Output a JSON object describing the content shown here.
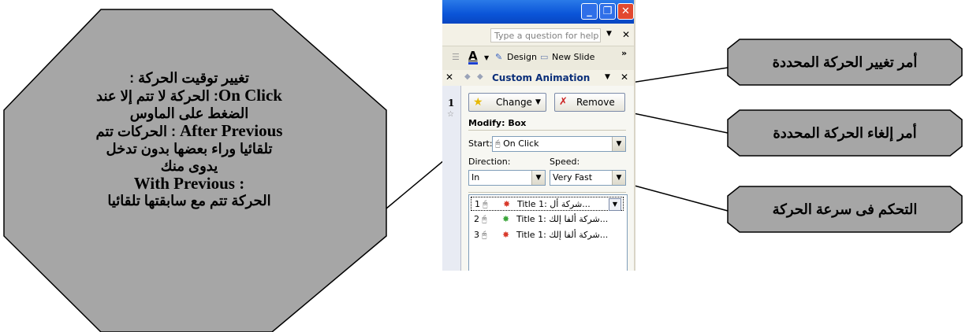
{
  "callouts": {
    "timing": {
      "line1": "تغيير توقيت الحركة :",
      "line2_en": "On Click",
      "line2_ar": ": الحركة لا تتم إلا عند",
      "line3": "الضغط على الماوس",
      "line4_en": "After Previous",
      "line4_ar": " : الحركات تتم",
      "line5": "تلقائيا وراء بعضها بدون تدخل",
      "line6": "يدوى منك",
      "line7": ": With Previous",
      "line8": "الحركة تتم مع سابقتها تلقائيا"
    },
    "change": "أمر تغيير الحركة المحددة",
    "remove": "أمر إلغاء الحركة المحددة",
    "speed": "التحكم فى سرعة الحركة"
  },
  "window": {
    "help_placeholder": "Type a question for help",
    "toolbar": {
      "design": "Design",
      "new_slide": "New Slide"
    },
    "task_pane": {
      "title": "Custom Animation",
      "slide_number": "1",
      "change_button": "Change",
      "remove_button": "Remove",
      "modify_label": "Modify: Box",
      "start_label": "Start:",
      "start_value": "On Click",
      "direction_label": "Direction:",
      "direction_value": "In",
      "speed_label": "Speed:",
      "speed_value": "Very Fast",
      "animation_list": [
        {
          "num": "1",
          "text": "Title 1: شركة أل..."
        },
        {
          "num": "2",
          "text": "Title 1: شركة ألفا إلك..."
        },
        {
          "num": "3",
          "text": "Title 1: شركة ألفا إلك..."
        }
      ]
    }
  },
  "colors": {
    "callout_fill": "#a6a6a6",
    "titlebar_blue": "#0a54d8",
    "close_red": "#e2492f"
  }
}
